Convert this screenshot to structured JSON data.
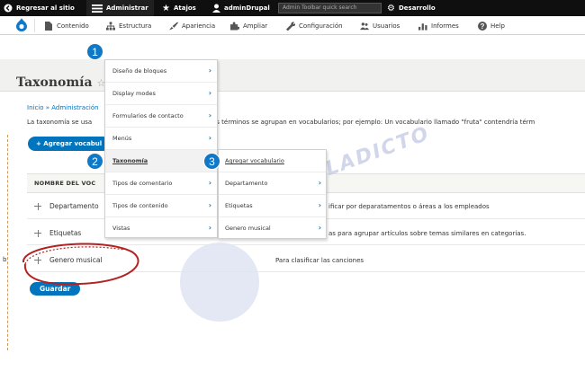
{
  "toolbar": {
    "back": "Regresar al sitio",
    "admin": "Administrar",
    "shortcuts": "Atajos",
    "user": "adminDrupal",
    "search_placeholder": "Admin Toolbar quick search",
    "dev": "Desarrollo"
  },
  "subbar": {
    "content": "Contenido",
    "structure": "Estructura",
    "appearance": "Apariencia",
    "extend": "Ampliar",
    "config": "Configuración",
    "people": "Usuarios",
    "reports": "Informes",
    "help": "Help"
  },
  "page": {
    "title": "Taxonomía",
    "title_suffix": "☆",
    "breadcrumb": "Inicio » Administración",
    "desc_left": "La taxonomía se usa",
    "desc_right": "os términos se agrupan en vocabularios; por ejemplo: Un vocabulario llamado \"fruta\" contendría térm",
    "add_button": "+ Agregar vocabul",
    "column_name": "NOMBRE DEL VOC",
    "save_button": "Guardar"
  },
  "rows": [
    {
      "name": "Departamento",
      "desc": "ificar por deparatamentos o áreas a los empleados"
    },
    {
      "name": "Etiquetas",
      "desc": "as para agrupar artículos sobre temas similares en categorías."
    },
    {
      "name": "Genero musical",
      "desc": "Para clasificar las canciones"
    }
  ],
  "menu1": [
    "Diseño de bloques",
    "Display modes",
    "Formularios de contacto",
    "Menús",
    "Taxonomía",
    "Tipos de comentario",
    "Tipos de contenido",
    "Vistas"
  ],
  "menu2": [
    "Agregar vocabulario",
    "Departamento",
    "Etiquetas",
    "Genero musical"
  ],
  "badges": [
    "1",
    "2",
    "3"
  ],
  "watermark": "DRUPALADICTO",
  "colors": {
    "accent": "#0074bd",
    "toolbar": "#0f0f0f",
    "badge": "#0f79c7",
    "annotation": "#b22222"
  }
}
